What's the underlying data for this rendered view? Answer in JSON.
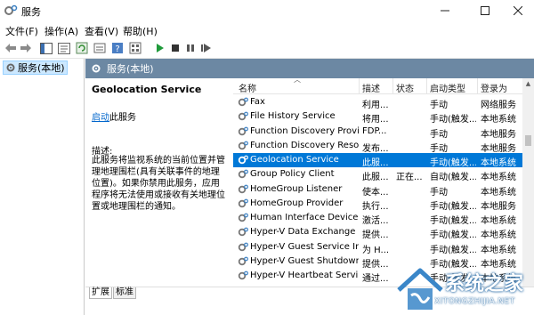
{
  "window": {
    "title": "服务"
  },
  "menu": [
    "文件(F)",
    "操作(A)",
    "查看(V)",
    "帮助(H)"
  ],
  "tree": {
    "item": "服务(本地)"
  },
  "content_header": {
    "title": "服务(本地)"
  },
  "detail": {
    "service_name": "Geolocation Service",
    "start_link": "启动",
    "start_suffix": "此服务",
    "desc_label": "描述:",
    "description": "此服务将监视系统的当前位置并管理地理围栏(具有关联事件的地理位置)。如果你禁用此服务，应用程序将无法使用或接收有关地理位置或地理围栏的通知。"
  },
  "columns": [
    "名称",
    "描述",
    "状态",
    "启动类型",
    "登录为"
  ],
  "rows": [
    {
      "name": "Fax",
      "desc": "利用...",
      "status": "",
      "start": "手动",
      "logon": "网络服务"
    },
    {
      "name": "File History Service",
      "desc": "将用...",
      "status": "",
      "start": "手动(触发...",
      "logon": "本地系统"
    },
    {
      "name": "Function Discovery Provi...",
      "desc": "FDP...",
      "status": "",
      "start": "手动",
      "logon": "本地服务"
    },
    {
      "name": "Function Discovery Reso...",
      "desc": "发布...",
      "status": "",
      "start": "手动",
      "logon": "本地服务"
    },
    {
      "name": "Geolocation Service",
      "desc": "此服...",
      "status": "",
      "start": "手动(触发...",
      "logon": "本地系统",
      "selected": true
    },
    {
      "name": "Group Policy Client",
      "desc": "此服...",
      "status": "正在...",
      "start": "自动(触发...",
      "logon": "本地系统"
    },
    {
      "name": "HomeGroup Listener",
      "desc": "使本...",
      "status": "",
      "start": "手动",
      "logon": "本地系统"
    },
    {
      "name": "HomeGroup Provider",
      "desc": "执行...",
      "status": "",
      "start": "手动(触发...",
      "logon": "本地服务"
    },
    {
      "name": "Human Interface Device ...",
      "desc": "激活...",
      "status": "",
      "start": "手动(触发...",
      "logon": "本地系统"
    },
    {
      "name": "Hyper-V Data Exchange ...",
      "desc": "提供...",
      "status": "",
      "start": "手动(触发...",
      "logon": "本地系统"
    },
    {
      "name": "Hyper-V Guest Service In...",
      "desc": "为 H...",
      "status": "",
      "start": "手动(触发...",
      "logon": "本地系统"
    },
    {
      "name": "Hyper-V Guest Shutdown...",
      "desc": "提供...",
      "status": "",
      "start": "手动(触发...",
      "logon": "本地系统"
    },
    {
      "name": "Hyper-V Heartbeat Service",
      "desc": "通过...",
      "status": "",
      "start": "手动(触发...",
      "logon": "本地系统"
    }
  ],
  "tabs": [
    "扩展",
    "标准"
  ],
  "watermark": {
    "brand": "系统之家",
    "url": "XITONGZHIJIA.NET"
  },
  "colors": {
    "header_band": "#6c88a3",
    "selection": "#0078d7",
    "tree_selection": "#cce8ff"
  },
  "icons": [
    "app-icon",
    "back-icon",
    "forward-icon",
    "console-tree-icon",
    "properties-icon",
    "refresh-icon",
    "export-icon",
    "help-icon",
    "view-icon",
    "start-icon",
    "stop-icon",
    "pause-icon",
    "restart-icon",
    "gear-icon"
  ]
}
